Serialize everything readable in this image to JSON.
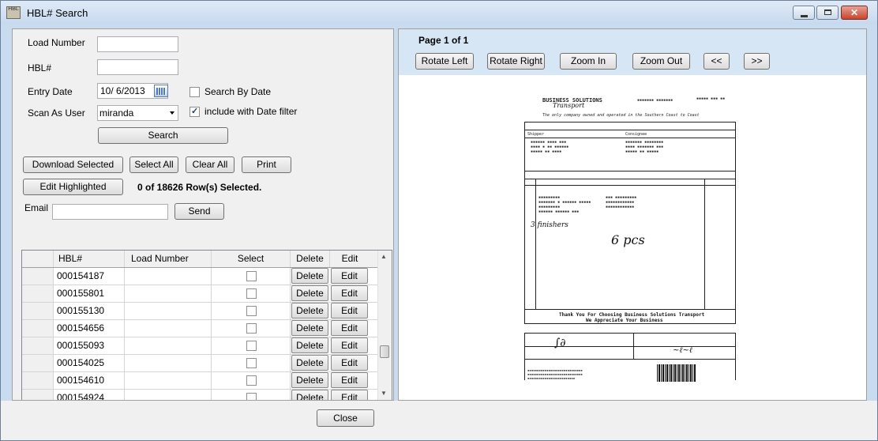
{
  "window": {
    "title": "HBL# Search",
    "app_icon_text": "HBL"
  },
  "search_form": {
    "load_number_label": "Load Number",
    "load_number_value": "",
    "hbl_label": "HBL#",
    "hbl_value": "",
    "entry_date_label": "Entry Date",
    "entry_date_value": "10/ 6/2013",
    "search_by_date_label": "Search By Date",
    "search_by_date_checked": false,
    "scan_as_user_label": "Scan As User",
    "scan_as_user_value": "miranda",
    "include_date_filter_label": "include with Date filter",
    "include_date_filter_checked": true,
    "search_button": "Search"
  },
  "actions": {
    "download_selected": "Download Selected",
    "select_all": "Select All",
    "clear_all": "Clear All",
    "print": "Print",
    "edit_highlighted": "Edit Highlighted",
    "selection_status": "0 of  18626 Row(s) Selected.",
    "email_label": "Email",
    "email_value": "",
    "send_button": "Send"
  },
  "grid": {
    "columns": [
      "HBL#",
      "Load Number",
      "Select",
      "Delete",
      "Edit"
    ],
    "delete_label": "Delete",
    "edit_label": "Edit",
    "rows": [
      {
        "hbl": "000154187",
        "load_number": "",
        "selected": false
      },
      {
        "hbl": "000155801",
        "load_number": "",
        "selected": false
      },
      {
        "hbl": "000155130",
        "load_number": "",
        "selected": false
      },
      {
        "hbl": "000154656",
        "load_number": "",
        "selected": false
      },
      {
        "hbl": "000155093",
        "load_number": "",
        "selected": false
      },
      {
        "hbl": "000154025",
        "load_number": "",
        "selected": false
      },
      {
        "hbl": "000154610",
        "load_number": "",
        "selected": false
      },
      {
        "hbl": "000154924",
        "load_number": "",
        "selected": false
      }
    ]
  },
  "viewer": {
    "page_info": "Page 1 of 1",
    "rotate_left": "Rotate Left",
    "rotate_right": "Rotate Right",
    "zoom_in": "Zoom In",
    "zoom_out": "Zoom Out",
    "prev": "<<",
    "next": ">>",
    "document": {
      "company": "BUSINESS SOLUTIONS",
      "company_script": "Transport",
      "tagline": "The only company owned and operated in the Southern Coast to Coast",
      "thanks_line_1": "Thank You For Choosing Business Solutions Transport",
      "thanks_line_2": "We Appreciate Your Business",
      "shipper_label": "Shipper",
      "consignee_label": "Consignee",
      "handwritten_pieces": "6 pcs",
      "handwritten_note": "3 finishers"
    }
  },
  "footer": {
    "close_button": "Close"
  },
  "colors": {
    "window_frame": "#c9dcef",
    "toolbar_bg": "#d7e6f5",
    "close_button_red": "#c8452c"
  }
}
